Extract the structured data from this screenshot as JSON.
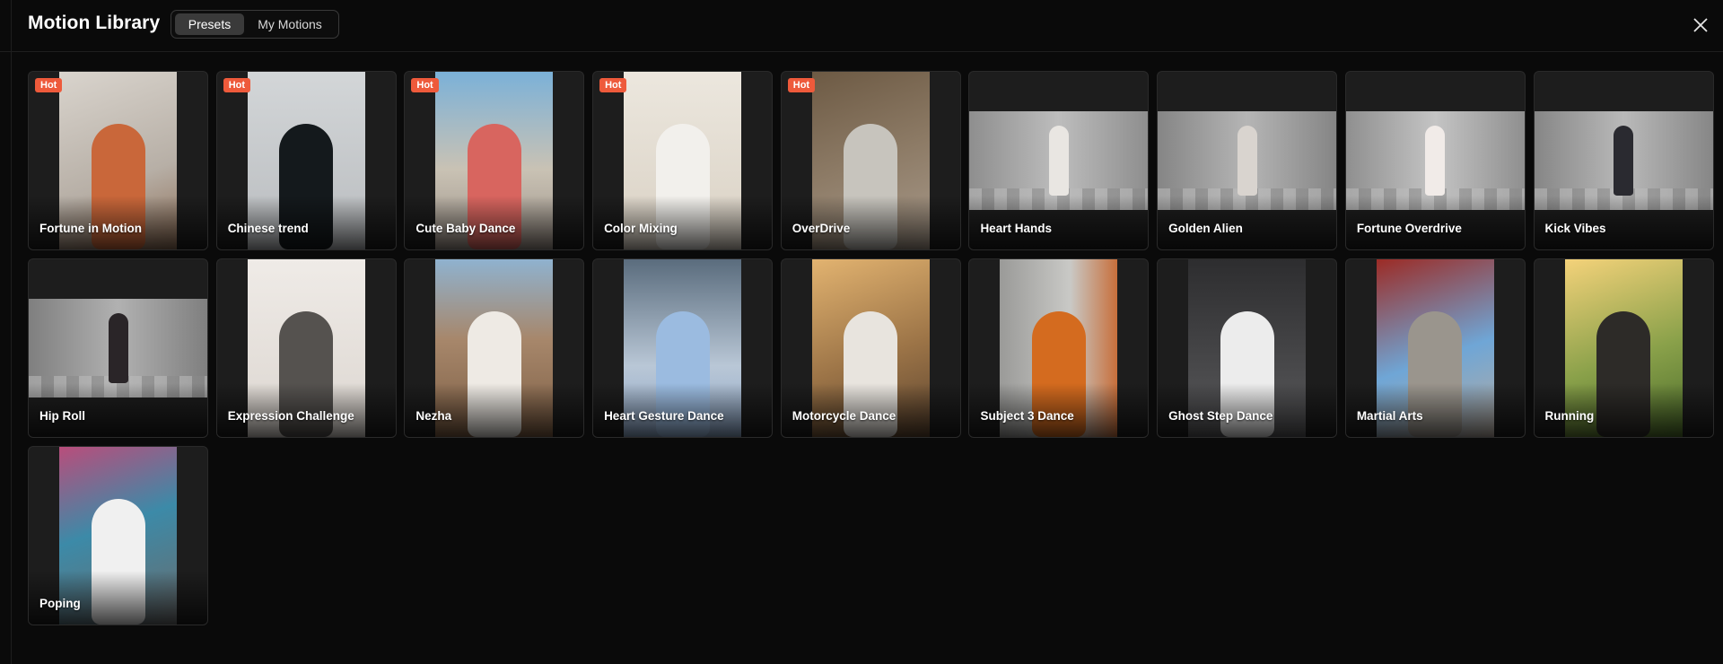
{
  "header": {
    "title": "Motion Library"
  },
  "tabs": [
    {
      "label": "Presets",
      "active": true
    },
    {
      "label": "My Motions",
      "active": false
    }
  ],
  "badge_label": "Hot",
  "cards": [
    {
      "label": "Fortune in Motion",
      "hot": true,
      "layout": "portrait",
      "bg": "linear-gradient(160deg,#d9d4cd,#b7afa6 60%,#8d6d55)",
      "fig": "#c9673a"
    },
    {
      "label": "Chinese trend",
      "hot": true,
      "layout": "portrait",
      "bg": "linear-gradient(180deg,#d3d6d8,#b9bcbf)",
      "fig": "#14191c"
    },
    {
      "label": "Cute Baby Dance",
      "hot": true,
      "layout": "portrait",
      "bg": "linear-gradient(180deg,#7bb1d8,#c9c2b4 55%,#9d9289)",
      "fig": "#d8655f"
    },
    {
      "label": "Color Mixing",
      "hot": true,
      "layout": "portrait",
      "bg": "linear-gradient(180deg,#ece7de,#d9d1c4)",
      "fig": "#f2f0ec"
    },
    {
      "label": "OverDrive",
      "hot": true,
      "layout": "portrait",
      "bg": "linear-gradient(160deg,#6d5a44,#8d7b66 50%,#a89a8b)",
      "fig": "#c7c4bd"
    },
    {
      "label": "Heart Hands",
      "hot": false,
      "layout": "landscape",
      "bg": "linear-gradient(90deg,#8e8e8e,#bdbdbd,#8e8e8e)",
      "fig": "#e9e6e2"
    },
    {
      "label": "Golden Alien",
      "hot": false,
      "layout": "landscape",
      "bg": "linear-gradient(90deg,#858585,#b5b5b5,#858585)",
      "fig": "#d9d4cf"
    },
    {
      "label": "Fortune Overdrive",
      "hot": false,
      "layout": "landscape",
      "bg": "linear-gradient(90deg,#8f8f8f,#c4c4c4,#8f8f8f)",
      "fig": "#f1ebe8"
    },
    {
      "label": "Kick Vibes",
      "hot": false,
      "layout": "landscape",
      "bg": "linear-gradient(90deg,#868686,#b9b9b9,#868686)",
      "fig": "#2a2a30"
    },
    {
      "label": "Hip Roll",
      "hot": false,
      "layout": "landscape",
      "bg": "linear-gradient(90deg,#7f7f7f,#b1b1b1,#7f7f7f)",
      "fig": "#2a2528"
    },
    {
      "label": "Expression Challenge",
      "hot": false,
      "layout": "portrait",
      "bg": "linear-gradient(180deg,#efebe7,#dcd6d0)",
      "fig": "#55524f"
    },
    {
      "label": "Nezha",
      "hot": false,
      "layout": "portrait",
      "bg": "linear-gradient(180deg,#8fb2cf,#a7876b 45%,#7d5e44)",
      "fig": "#eeeae4"
    },
    {
      "label": "Heart Gesture Dance",
      "hot": false,
      "layout": "portrait",
      "bg": "linear-gradient(180deg,#5a6c7d,#b9c7d6 60%,#8ea7c8)",
      "fig": "#9bbbe0"
    },
    {
      "label": "Motorcycle Dance",
      "hot": false,
      "layout": "portrait",
      "bg": "linear-gradient(160deg,#e2b370,#9c7447 55%,#5d4530)",
      "fig": "#e8e4de"
    },
    {
      "label": "Subject 3 Dance",
      "hot": false,
      "layout": "portrait",
      "bg": "linear-gradient(90deg,#9a9a98,#c9c9c6 60%,#c76f3b)",
      "fig": "#d46b1f"
    },
    {
      "label": "Ghost Step Dance",
      "hot": false,
      "layout": "portrait",
      "bg": "linear-gradient(180deg,#2d2d2f,#5a5a5c)",
      "fig": "#ececec"
    },
    {
      "label": "Martial Arts",
      "hot": false,
      "layout": "portrait",
      "bg": "linear-gradient(160deg,#9c2b25,#6fa6d6 55%,#b8aca0)",
      "fig": "#9a958d"
    },
    {
      "label": "Running",
      "hot": false,
      "layout": "portrait",
      "bg": "linear-gradient(160deg,#f4d27a,#8aa14a 55%,#4c6d2b)",
      "fig": "#2d2b28"
    },
    {
      "label": "Poping",
      "hot": false,
      "layout": "portrait",
      "bg": "linear-gradient(160deg,#b94d7b,#3c8aa8 45%,#6b6b6b)",
      "fig": "#f0f0f0"
    }
  ]
}
